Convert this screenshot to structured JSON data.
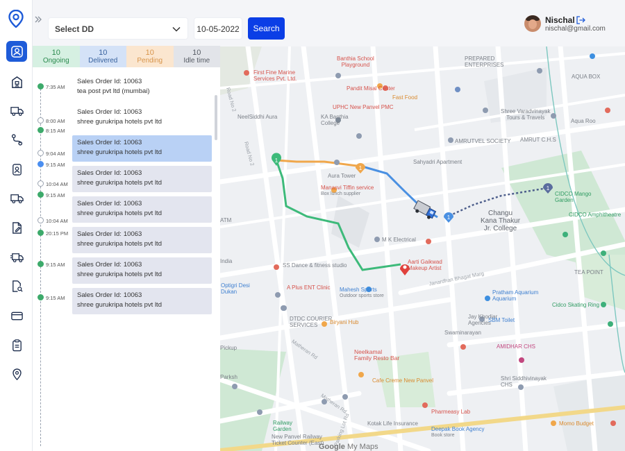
{
  "nav": {
    "items": [
      {
        "icon": "user-account-icon",
        "active": true
      },
      {
        "icon": "building-icon",
        "active": false
      },
      {
        "icon": "delivery-truck-icon",
        "active": false
      },
      {
        "icon": "route-icon",
        "active": false
      },
      {
        "icon": "id-badge-icon",
        "active": false
      },
      {
        "icon": "truck-icon",
        "active": false
      },
      {
        "icon": "edit-document-icon",
        "active": false
      },
      {
        "icon": "truck-fast-icon",
        "active": false
      },
      {
        "icon": "document-search-icon",
        "active": false
      },
      {
        "icon": "credit-card-icon",
        "active": false
      },
      {
        "icon": "clipboard-icon",
        "active": false
      },
      {
        "icon": "location-pin-icon",
        "active": false
      }
    ]
  },
  "topbar": {
    "select_label": "Select DD",
    "date_value": "10-05-2022",
    "search_label": "Search"
  },
  "user": {
    "name": "Nischal",
    "email": "nischal@gmail.com"
  },
  "tabs": [
    {
      "count": "10",
      "label": "Ongoing"
    },
    {
      "count": "10",
      "label": "Delivered"
    },
    {
      "count": "10",
      "label": "Pending"
    },
    {
      "count": "10",
      "label": "Idle time"
    }
  ],
  "timeline": {
    "times": [
      "7:35 AM",
      "8:00 AM",
      "8:15 AM",
      "9:04 AM",
      "9:15 AM",
      "10:04 AM",
      "9:15 AM",
      "10:04 AM",
      "20:15 PM",
      "9:15 AM",
      "9:15 AM"
    ],
    "order_key": "Sales Order Id:",
    "orders": [
      {
        "id": "10063",
        "customer": "tea post pvt ltd (mumbai)"
      },
      {
        "id": "10063",
        "customer": "shree gurukripa hotels pvt ltd"
      },
      {
        "id": "10063",
        "customer": "shree gurukripa hotels pvt ltd"
      },
      {
        "id": "10063",
        "customer": "shree gurukripa hotels pvt ltd"
      },
      {
        "id": "10063",
        "customer": "shree gurukripa hotels pvt ltd"
      },
      {
        "id": "10063",
        "customer": "shree gurukripa hotels pvt ltd"
      },
      {
        "id": "10063",
        "customer": "shree gurukripa hotels pvt ltd"
      },
      {
        "id": "10063",
        "customer": "shree gurukripa hotels pvt ltd"
      }
    ]
  },
  "map": {
    "labels": {
      "banthia": "Banthia School\nPlayground",
      "firstfine": "First Fine Marine\nServices Pvt. Ltd.",
      "pandit": "Pandit Misal Center",
      "fastfood": "Fast Food",
      "uphc": "UPHC New Panvel PMC",
      "neelsiddhi": "NeelSiddhi Aura",
      "kabanthia": "KA Banthia\nCollege",
      "prepared": "PREPARED\nENTERPRISES",
      "aquabox": "AQUA BOX",
      "sheetal": "Shree Varadvinayak\nTours & Travels",
      "aquaroo": "Aqua Roo",
      "amrut": "AMRUTVEL SOCIETY",
      "amrutdev": "AMRUT C.H.S",
      "sahyadri": "Sahyadri Apartment",
      "auratower": "Aura Tower",
      "manasvi": "Manasvi Tiffin service",
      "manasvi2": "Box lunch supplier",
      "cidco": "CIDCO Mango\nGarden",
      "changu": "Changu\nKana Thakur\nJr. College",
      "cidcoamp": "CIDCO Amphitheatre",
      "mkelec": "M K Electrical",
      "ssdance": "SS Dance & fitness studio",
      "aarti": "Aarti Gaikwad\nMakeup Artist",
      "aplus": "A Plus ENT Clinic",
      "mahesh": "Mahesh Sports",
      "outdoor": "Outdoor sports store",
      "prathamaq": "Pratham Aquarium",
      "prathamsub": "Aquarium",
      "teapoint": "TEA POINT",
      "cidcoskate": "Cidco Skating Ring",
      "janardhan": "Janardhan Bhagat Marg",
      "dtdc": "DTDC COURIER\nSERVICES",
      "biryani": "Biryani Hub",
      "neelkamal": "Neelkamal\nFamily Resto Bar",
      "cafe": "Cafe Creme New Panvel",
      "jaykhodiar": "Jay Khodiar\nAgencies",
      "sbm": "SBM Toilet",
      "swami": "Swaminarayan",
      "amidhar": "AMIDHAR CHS",
      "shrinath": "Shri Siddhivinayak\nCHS",
      "pharmeasy": "Pharmeasy Lab",
      "newpanvel": "New Panvel Railway\nTicket Counter (East)",
      "kotak": "Kotak Life Insurance",
      "deepak": "Deepak Book Agency",
      "bookstore": "Book store",
      "momo": "Momo Budget",
      "railway": "Railway\nGarden",
      "opti": "Optigri Desi\nDukan",
      "matheran": "Matheran Rd",
      "matheran2": "Matheran Rd",
      "parking": "Parking Lot Rd",
      "roadno2a": "Road No 2",
      "roadno2b": "Road No 2",
      "atm": "ATM",
      "india": "India",
      "pickup": "Pickup",
      "parksh": "Parksh",
      "google_brand": "Google",
      "google_suffix": "My Maps"
    },
    "markers": {
      "start": "1",
      "mid1": "1",
      "mid2": "1",
      "end": "1"
    }
  }
}
